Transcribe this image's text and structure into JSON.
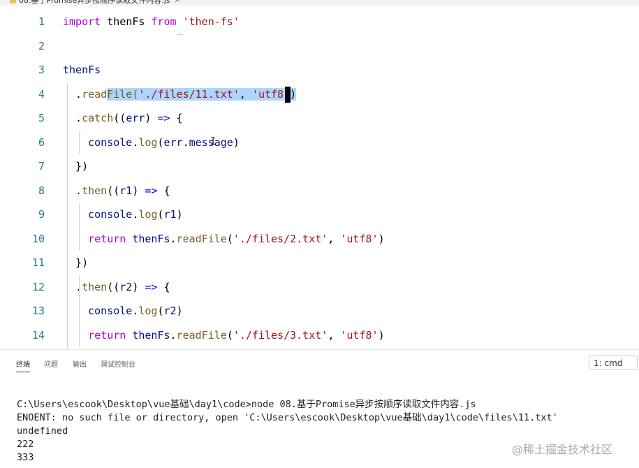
{
  "tab": {
    "title": "08.基于Promise异步按顺序读取文件内容.js",
    "close": "×"
  },
  "editor": {
    "hover_ellipsis": "…",
    "lines": [
      {
        "n": "1",
        "tokens": [
          {
            "t": "import",
            "c": "kw2"
          },
          {
            "t": " thenFs ",
            "c": "ident"
          },
          {
            "t": "from",
            "c": "kw2"
          },
          {
            "t": " ",
            "c": "ident"
          },
          {
            "t": "'then-fs'",
            "c": "str"
          }
        ]
      },
      {
        "n": "2",
        "tokens": []
      },
      {
        "n": "3",
        "tokens": [
          {
            "t": "thenFs",
            "c": "var"
          }
        ]
      },
      {
        "n": "4",
        "tokens": [
          {
            "t": "  .",
            "c": "ident"
          },
          {
            "t": "read",
            "c": "fn"
          },
          {
            "t": "File(",
            "c": "fn",
            "sel": true
          },
          {
            "t": "'./files/11.txt'",
            "c": "str",
            "sel": true
          },
          {
            "t": ", ",
            "c": "ident",
            "sel": true
          },
          {
            "t": "'utf8'",
            "c": "str",
            "sel": true
          },
          {
            "t": ")",
            "c": "ident",
            "sel": true
          }
        ]
      },
      {
        "n": "5",
        "tokens": [
          {
            "t": "  .",
            "c": "ident"
          },
          {
            "t": "catch",
            "c": "fn"
          },
          {
            "t": "((",
            "c": "ident"
          },
          {
            "t": "err",
            "c": "var"
          },
          {
            "t": ") ",
            "c": "ident"
          },
          {
            "t": "=>",
            "c": "kw"
          },
          {
            "t": " {",
            "c": "ident"
          }
        ]
      },
      {
        "n": "6",
        "tokens": [
          {
            "t": "    console",
            "c": "var"
          },
          {
            "t": ".",
            "c": "ident"
          },
          {
            "t": "log",
            "c": "fn"
          },
          {
            "t": "(",
            "c": "ident"
          },
          {
            "t": "err",
            "c": "var"
          },
          {
            "t": ".",
            "c": "ident"
          },
          {
            "t": "message",
            "c": "var"
          },
          {
            "t": ")",
            "c": "ident"
          }
        ]
      },
      {
        "n": "7",
        "tokens": [
          {
            "t": "  })",
            "c": "ident"
          }
        ]
      },
      {
        "n": "8",
        "tokens": [
          {
            "t": "  .",
            "c": "ident"
          },
          {
            "t": "then",
            "c": "fn"
          },
          {
            "t": "((",
            "c": "ident"
          },
          {
            "t": "r1",
            "c": "var"
          },
          {
            "t": ") ",
            "c": "ident"
          },
          {
            "t": "=>",
            "c": "kw"
          },
          {
            "t": " {",
            "c": "ident"
          }
        ]
      },
      {
        "n": "9",
        "tokens": [
          {
            "t": "    console",
            "c": "var"
          },
          {
            "t": ".",
            "c": "ident"
          },
          {
            "t": "log",
            "c": "fn"
          },
          {
            "t": "(",
            "c": "ident"
          },
          {
            "t": "r1",
            "c": "var"
          },
          {
            "t": ")",
            "c": "ident"
          }
        ]
      },
      {
        "n": "10",
        "tokens": [
          {
            "t": "    return",
            "c": "kw2"
          },
          {
            "t": " thenFs",
            "c": "var"
          },
          {
            "t": ".",
            "c": "ident"
          },
          {
            "t": "readFile",
            "c": "fn"
          },
          {
            "t": "(",
            "c": "ident"
          },
          {
            "t": "'./files/2.txt'",
            "c": "str"
          },
          {
            "t": ", ",
            "c": "ident"
          },
          {
            "t": "'utf8'",
            "c": "str"
          },
          {
            "t": ")",
            "c": "ident"
          }
        ]
      },
      {
        "n": "11",
        "tokens": [
          {
            "t": "  })",
            "c": "ident"
          }
        ]
      },
      {
        "n": "12",
        "tokens": [
          {
            "t": "  .",
            "c": "ident"
          },
          {
            "t": "then",
            "c": "fn"
          },
          {
            "t": "((",
            "c": "ident"
          },
          {
            "t": "r2",
            "c": "var"
          },
          {
            "t": ") ",
            "c": "ident"
          },
          {
            "t": "=>",
            "c": "kw"
          },
          {
            "t": " {",
            "c": "ident"
          }
        ]
      },
      {
        "n": "13",
        "tokens": [
          {
            "t": "    console",
            "c": "var"
          },
          {
            "t": ".",
            "c": "ident"
          },
          {
            "t": "log",
            "c": "fn"
          },
          {
            "t": "(",
            "c": "ident"
          },
          {
            "t": "r2",
            "c": "var"
          },
          {
            "t": ")",
            "c": "ident"
          }
        ]
      },
      {
        "n": "14",
        "tokens": [
          {
            "t": "    return",
            "c": "kw2"
          },
          {
            "t": " thenFs",
            "c": "var"
          },
          {
            "t": ".",
            "c": "ident"
          },
          {
            "t": "readFile",
            "c": "fn"
          },
          {
            "t": "(",
            "c": "ident"
          },
          {
            "t": "'./files/3.txt'",
            "c": "str"
          },
          {
            "t": ", ",
            "c": "ident"
          },
          {
            "t": "'utf8'",
            "c": "str"
          },
          {
            "t": ")",
            "c": "ident"
          }
        ]
      }
    ]
  },
  "panel": {
    "tabs": [
      "终端",
      "问题",
      "输出",
      "调试控制台"
    ],
    "active_tab": "终端",
    "terminal_select": "1: cmd"
  },
  "terminal": {
    "lines": [
      "C:\\Users\\escook\\Desktop\\vue基础\\day1\\code>node 08.基于Promise异步按顺序读取文件内容.js",
      "ENOENT: no such file or directory, open 'C:\\Users\\escook\\Desktop\\vue基础\\day1\\code\\files\\11.txt'",
      "undefined",
      "222",
      "333"
    ]
  },
  "watermark": "@稀土掘金技术社区",
  "colors": {
    "keyword_purple": "#af00db",
    "keyword_blue": "#0000ff",
    "string": "#a31515",
    "function": "#795e26",
    "variable": "#001080",
    "line_number": "#237893",
    "selection": "#add6ff"
  }
}
